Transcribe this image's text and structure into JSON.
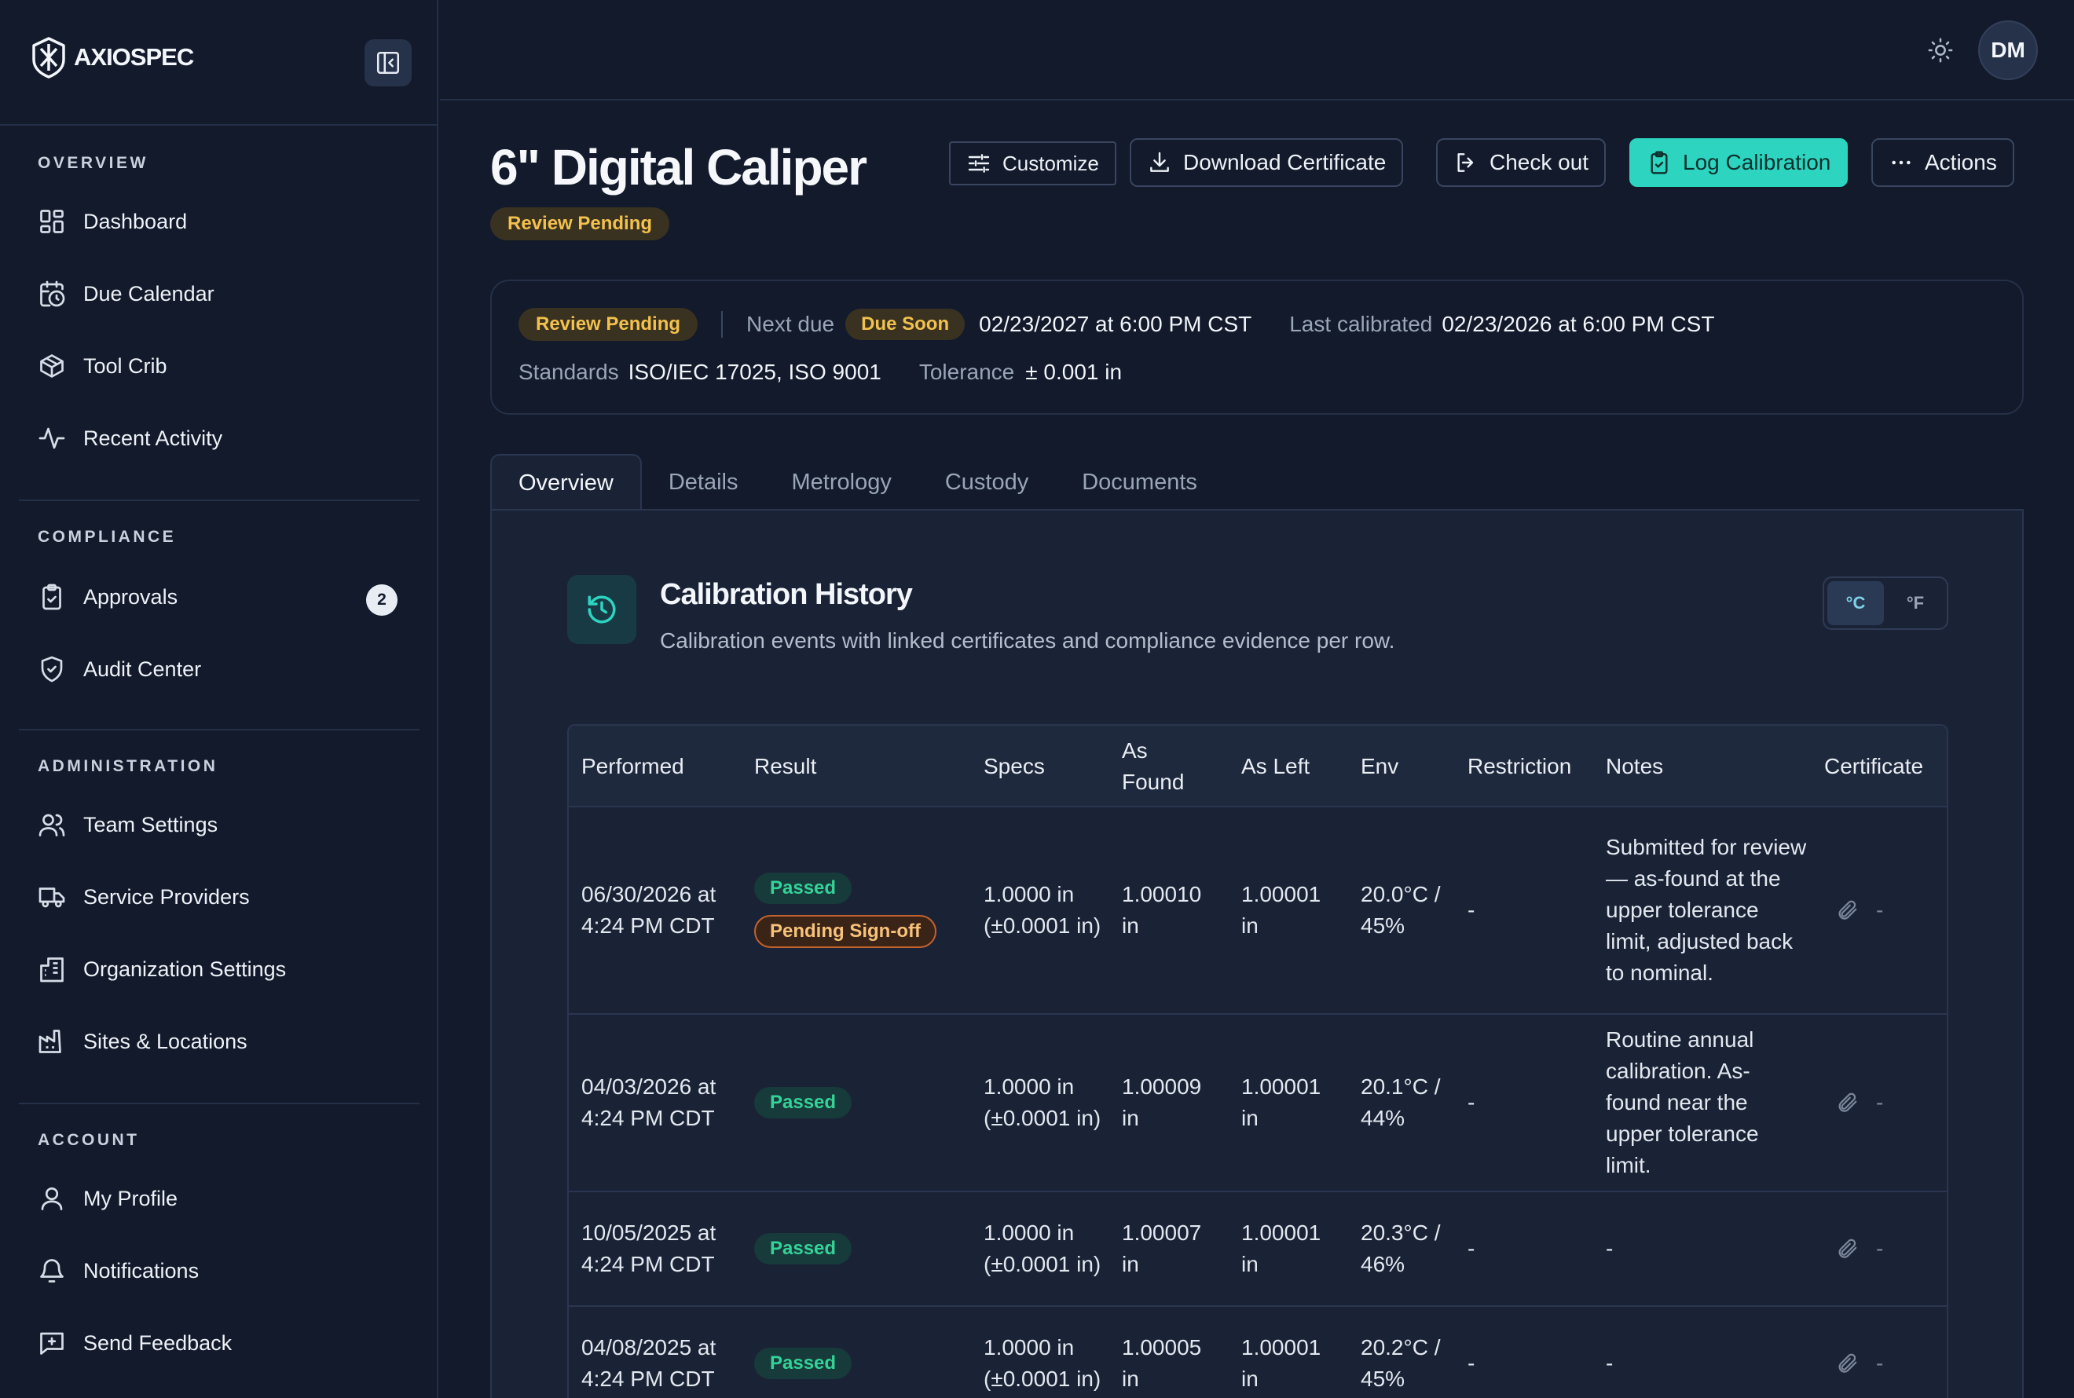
{
  "brand": {
    "name": "AXIOSPEC"
  },
  "sidebar": {
    "sections": [
      {
        "label": "OVERVIEW",
        "items": [
          {
            "label": "Dashboard",
            "icon": "dashboard-grid-icon"
          },
          {
            "label": "Due Calendar",
            "icon": "calendar-clock-icon"
          },
          {
            "label": "Tool Crib",
            "icon": "box-icon"
          },
          {
            "label": "Recent Activity",
            "icon": "activity-icon"
          }
        ]
      },
      {
        "label": "COMPLIANCE",
        "items": [
          {
            "label": "Approvals",
            "icon": "clipboard-check-icon",
            "badge": "2"
          },
          {
            "label": "Audit Center",
            "icon": "shield-check-icon"
          }
        ]
      },
      {
        "label": "ADMINISTRATION",
        "items": [
          {
            "label": "Team Settings",
            "icon": "users-icon"
          },
          {
            "label": "Service Providers",
            "icon": "truck-icon"
          },
          {
            "label": "Organization Settings",
            "icon": "building-icon"
          },
          {
            "label": "Sites & Locations",
            "icon": "factory-icon"
          }
        ]
      },
      {
        "label": "ACCOUNT",
        "items": [
          {
            "label": "My Profile",
            "icon": "user-icon"
          },
          {
            "label": "Notifications",
            "icon": "bell-icon"
          },
          {
            "label": "Send Feedback",
            "icon": "feedback-icon"
          }
        ]
      }
    ]
  },
  "topbar": {
    "avatar_initials": "DM"
  },
  "header": {
    "title": "6\" Digital Caliper",
    "status": "Review Pending",
    "buttons": {
      "customize": "Customize",
      "download": "Download Certificate",
      "checkout": "Check out",
      "log": "Log Calibration",
      "actions": "Actions"
    }
  },
  "summary": {
    "status": "Review Pending",
    "next_due_label": "Next due",
    "due_badge": "Due Soon",
    "next_due": "02/23/2027 at 6:00 PM CST",
    "last_label": "Last calibrated",
    "last_value": "02/23/2026 at 6:00 PM CST",
    "standards_label": "Standards",
    "standards_value": "ISO/IEC 17025, ISO 9001",
    "tolerance_label": "Tolerance",
    "tolerance_value": "± 0.001 in"
  },
  "tabs": [
    "Overview",
    "Details",
    "Metrology",
    "Custody",
    "Documents"
  ],
  "history": {
    "title": "Calibration History",
    "subtitle": "Calibration events with linked certificates and compliance evidence per row.",
    "units": [
      "°C",
      "°F"
    ],
    "columns": [
      "Performed",
      "Result",
      "Specs",
      "As Found",
      "As Left",
      "Env",
      "Restriction",
      "Notes",
      "Certificate"
    ],
    "rows": [
      {
        "performed": "06/30/2026 at 4:24 PM CDT",
        "result": "Passed",
        "extra": "Pending Sign-off",
        "specs": "1.0000 in (±0.0001 in)",
        "as_found": "1.00010 in",
        "as_left": "1.00001 in",
        "env": "20.0°C / 45%",
        "restriction": "-",
        "notes": "Submitted for review — as-found at the upper tolerance limit, adjusted back to nominal.",
        "certificate": "-"
      },
      {
        "performed": "04/03/2026 at 4:24 PM CDT",
        "result": "Passed",
        "specs": "1.0000 in (±0.0001 in)",
        "as_found": "1.00009 in",
        "as_left": "1.00001 in",
        "env": "20.1°C / 44%",
        "restriction": "-",
        "notes": "Routine annual calibration. As-found near the upper tolerance limit.",
        "certificate": "-"
      },
      {
        "performed": "10/05/2025 at 4:24 PM CDT",
        "result": "Passed",
        "specs": "1.0000 in (±0.0001 in)",
        "as_found": "1.00007 in",
        "as_left": "1.00001 in",
        "env": "20.3°C / 46%",
        "restriction": "-",
        "notes": "-",
        "certificate": "-"
      },
      {
        "performed": "04/08/2025 at 4:24 PM CDT",
        "result": "Passed",
        "specs": "1.0000 in (±0.0001 in)",
        "as_found": "1.00005 in",
        "as_left": "1.00001 in",
        "env": "20.2°C / 45%",
        "restriction": "-",
        "notes": "-",
        "certificate": "-"
      }
    ]
  }
}
